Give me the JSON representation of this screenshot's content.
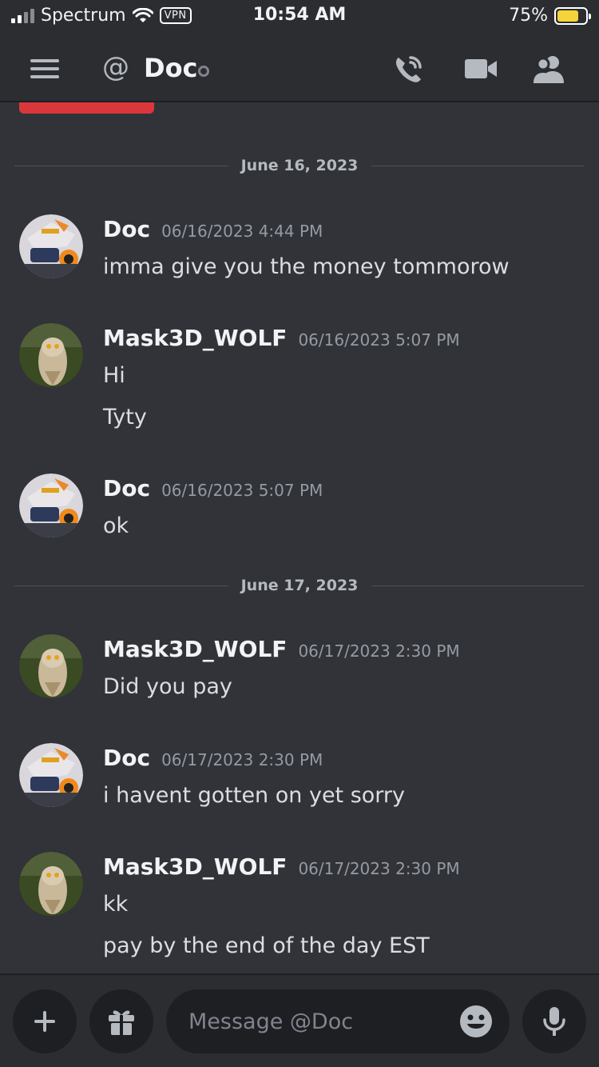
{
  "status_bar": {
    "carrier": "Spectrum",
    "vpn": "VPN",
    "time": "10:54 AM",
    "battery_percent": "75%",
    "battery_level": 0.75
  },
  "header": {
    "at_symbol": "@",
    "title": "Doc",
    "icons": [
      "hamburger-icon",
      "phone-call-icon",
      "video-camera-icon",
      "members-icon"
    ]
  },
  "colors": {
    "background": "#313338",
    "header_bg": "#2b2d31",
    "accent_red": "#da373c",
    "battery": "#f5d33b"
  },
  "dividers": [
    {
      "label": "June 16, 2023"
    },
    {
      "label": "June 17, 2023"
    }
  ],
  "messages": [
    {
      "author": "Doc",
      "timestamp": "06/16/2023 4:44 PM",
      "lines": [
        "imma give you the money tommorow"
      ]
    },
    {
      "author": "Mask3D_WOLF",
      "timestamp": "06/16/2023 5:07 PM",
      "lines": [
        "Hi",
        "Tyty"
      ]
    },
    {
      "author": "Doc",
      "timestamp": "06/16/2023 5:07 PM",
      "lines": [
        "ok"
      ]
    },
    {
      "author": "Mask3D_WOLF",
      "timestamp": "06/17/2023 2:30 PM",
      "lines": [
        "Did you pay"
      ]
    },
    {
      "author": "Doc",
      "timestamp": "06/17/2023 2:30 PM",
      "lines": [
        "i havent gotten on yet sorry"
      ]
    },
    {
      "author": "Mask3D_WOLF",
      "timestamp": "06/17/2023 2:30 PM",
      "lines": [
        "kk",
        "pay by the end of the day EST"
      ]
    }
  ],
  "composer": {
    "placeholder": "Message @Doc",
    "icons": [
      "plus-icon",
      "gift-icon",
      "emoji-icon",
      "microphone-icon"
    ]
  }
}
